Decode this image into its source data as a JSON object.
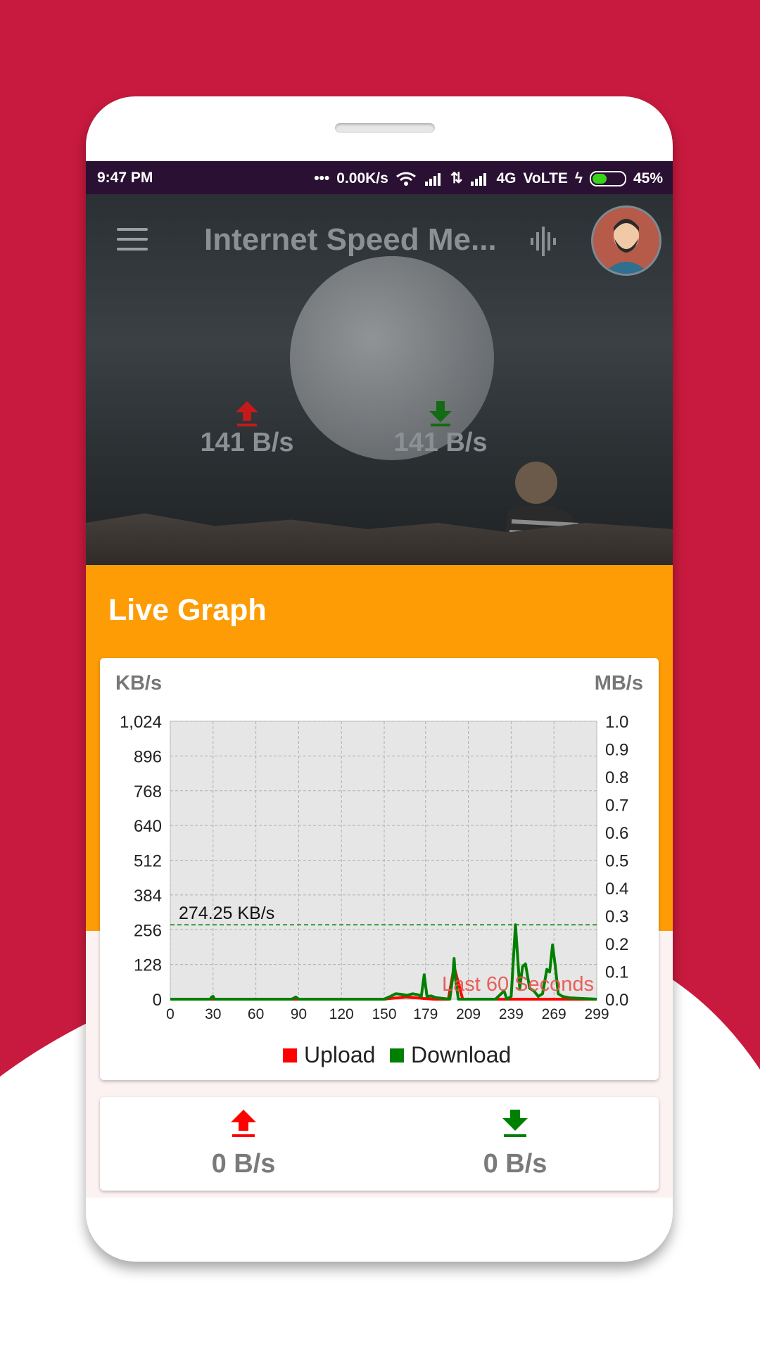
{
  "status_bar": {
    "time": "9:47 PM",
    "net_speed": "0.00K/s",
    "network": "4G",
    "volte": "VoLTE",
    "battery": "45%",
    "battery_level": 0.45
  },
  "app_bar": {
    "title": "Internet Speed Me..."
  },
  "hero": {
    "upload_speed": "141 B/s",
    "download_speed": "141 B/s"
  },
  "live_graph": {
    "title": "Live Graph",
    "left_unit": "KB/s",
    "right_unit": "MB/s"
  },
  "speed_card": {
    "upload_speed": "0 B/s",
    "download_speed": "0 B/s"
  },
  "colors": {
    "background": "#c81a3e",
    "accent_orange": "#fd9c05",
    "upload": "#ff0000",
    "download": "#008000"
  },
  "chart_data": {
    "type": "line",
    "title": "",
    "xlabel": "",
    "ylabel": "KB/s",
    "ylabel_right": "MB/s",
    "xlim": [
      0,
      299
    ],
    "ylim": [
      0,
      1024
    ],
    "ylim_right": [
      0,
      1.0
    ],
    "x_ticks": [
      "0",
      "30",
      "60",
      "90",
      "120",
      "150",
      "179",
      "209",
      "239",
      "269",
      "299"
    ],
    "y_ticks": [
      "0",
      "128",
      "256",
      "384",
      "512",
      "640",
      "768",
      "896",
      "1,024"
    ],
    "y_ticks_right": [
      "0.0",
      "0.1",
      "0.2",
      "0.3",
      "0.4",
      "0.5",
      "0.6",
      "0.7",
      "0.8",
      "0.9",
      "1.0"
    ],
    "grid": true,
    "legend": "bottom",
    "annotations": {
      "peak_label": "274.25 KB/s",
      "peak_value": 274.25,
      "window_label": "Last 60 Seconds"
    },
    "series": [
      {
        "name": "Upload",
        "color": "#ff0000",
        "x": [
          0,
          150,
          155,
          160,
          165,
          170,
          175,
          179,
          185,
          195,
          199,
          205,
          215,
          230,
          240,
          250,
          260,
          270,
          280,
          299
        ],
        "values": [
          0,
          0,
          3,
          5,
          8,
          6,
          4,
          2,
          0,
          0,
          120,
          0,
          0,
          0,
          0,
          0,
          0,
          0,
          0,
          0
        ]
      },
      {
        "name": "Download",
        "color": "#008000",
        "x": [
          0,
          28,
          29,
          30,
          31,
          85,
          87,
          88,
          89,
          90,
          150,
          155,
          158,
          162,
          166,
          170,
          174,
          176,
          178,
          180,
          183,
          186,
          196,
          198,
          199,
          200,
          202,
          220,
          228,
          230,
          234,
          236,
          239,
          242,
          245,
          247,
          249,
          252,
          255,
          258,
          261,
          264,
          266,
          268,
          270,
          272,
          275,
          280,
          299
        ],
        "values": [
          0,
          0,
          8,
          10,
          0,
          0,
          5,
          8,
          4,
          0,
          0,
          12,
          20,
          18,
          14,
          20,
          16,
          10,
          90,
          10,
          12,
          6,
          0,
          80,
          150,
          70,
          0,
          0,
          0,
          10,
          30,
          0,
          10,
          274,
          40,
          120,
          130,
          40,
          30,
          10,
          20,
          110,
          100,
          200,
          120,
          20,
          10,
          5,
          0
        ]
      }
    ]
  }
}
